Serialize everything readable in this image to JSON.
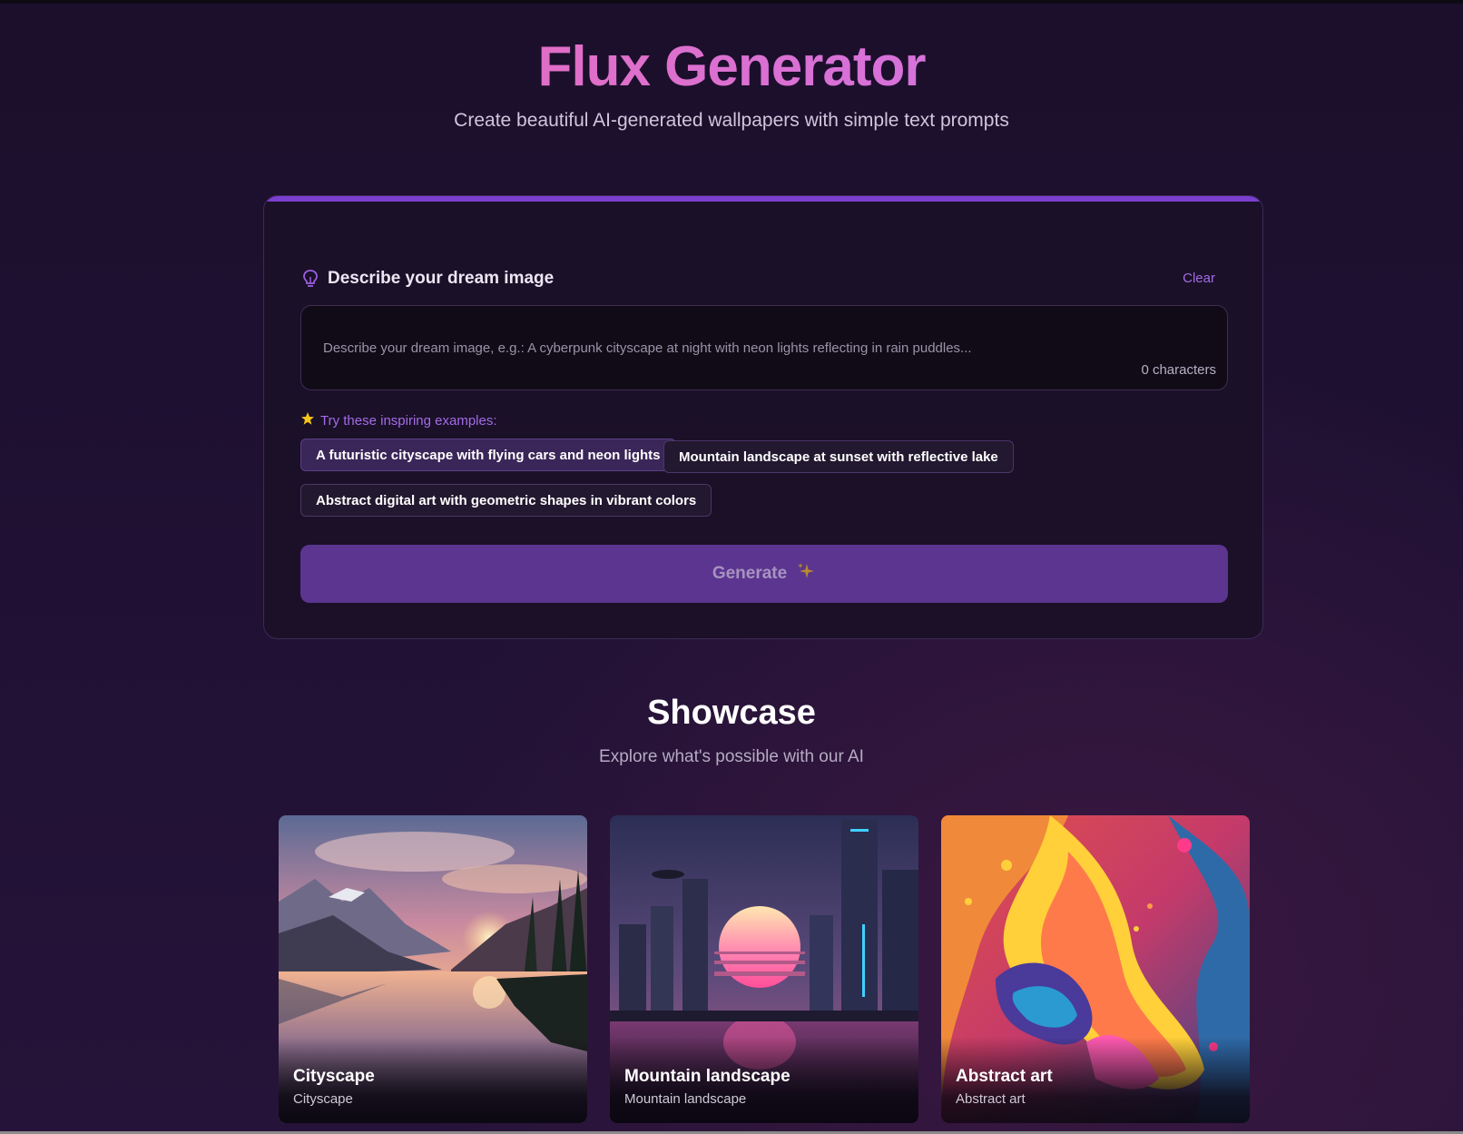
{
  "header": {
    "title": "Flux Generator",
    "subtitle": "Create beautiful AI-generated wallpapers with simple text prompts"
  },
  "prompt": {
    "label": "Describe your dream image",
    "icon": "lightbulb-icon",
    "clear_label": "Clear",
    "placeholder": "Describe your dream image, e.g.: A cyberpunk cityscape at night with neon lights reflecting in rain puddles...",
    "value": "",
    "char_count": "0 characters"
  },
  "examples": {
    "label": "Try these inspiring examples:",
    "icon": "star-icon",
    "items": [
      "A futuristic cityscape with flying cars and neon lights",
      "Mountain landscape at sunset with reflective lake",
      "Abstract digital art with geometric shapes in vibrant colors"
    ]
  },
  "generate": {
    "label": "Generate",
    "icon": "sparkles-icon"
  },
  "showcase": {
    "title": "Showcase",
    "subtitle": "Explore what's possible with our AI",
    "items": [
      {
        "title": "Cityscape",
        "subtitle": "Cityscape"
      },
      {
        "title": "Mountain landscape",
        "subtitle": "Mountain landscape"
      },
      {
        "title": "Abstract art",
        "subtitle": "Abstract art"
      }
    ]
  },
  "colors": {
    "accent": "#7b3fd0",
    "title_gradient_start": "#f06aa8",
    "title_gradient_end": "#c07ce6",
    "generate_button": "#5b3590",
    "link": "#a26be6"
  }
}
